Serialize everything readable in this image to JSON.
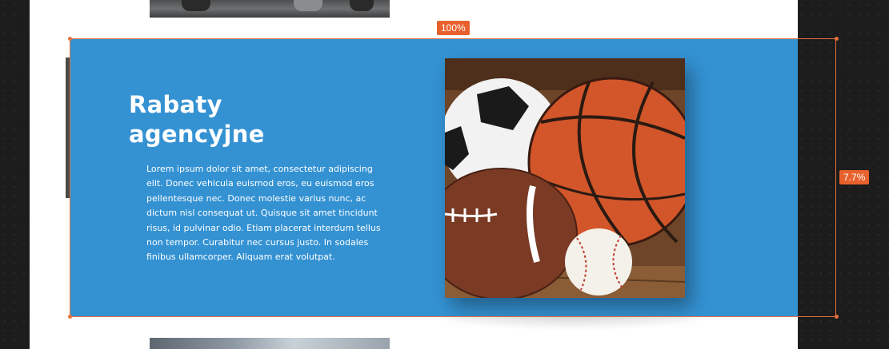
{
  "section": {
    "heading": [
      "Rabaty",
      "agencyjne"
    ],
    "body": [
      "Lorem ipsum dolor sit amet, consectetur adipiscing",
      "elit. Donec vehicula euismod eros, eu euismod eros",
      "pellentesque nec. Donec molestie varius nunc, ac",
      "dictum nisl consequat ut. Quisque sit amet tincidunt",
      "risus, id pulvinar odio. Etiam placerat interdum tellus",
      "non tempor. Curabitur nec cursus justo. In sodales",
      "finibus ullamcorper. Aliquam erat volutpat."
    ],
    "image": "sports-balls-image"
  },
  "editor": {
    "width_badge": "100%",
    "height_badge": "7.7%"
  },
  "colors": {
    "section_bg": "#3492d3",
    "selection": "#e8703a",
    "badge": "#e8612c"
  }
}
